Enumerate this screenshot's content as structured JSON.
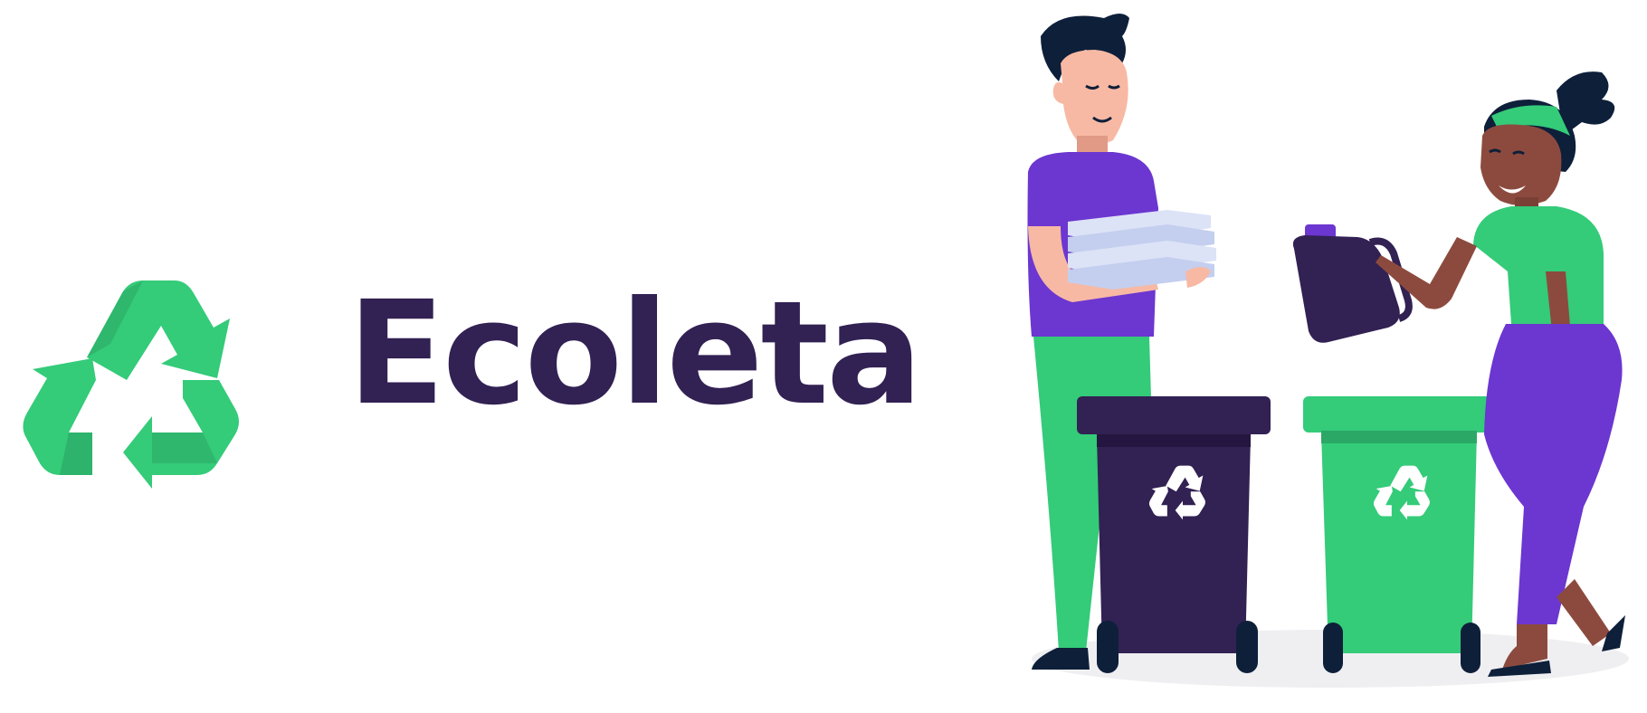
{
  "brand": {
    "name": "Ecoleta",
    "text_color": "#322153",
    "logo_icon": "recycle-icon",
    "accent_green": "#34CB79",
    "dark_green": "#2BA865"
  },
  "illustration": {
    "icons": [
      "man-figure",
      "woman-figure",
      "dark-recycle-bin",
      "green-recycle-bin",
      "paper-stack",
      "plastic-jug"
    ],
    "colors": {
      "purple": "#6C36D0",
      "dark": "#322153",
      "green": "#34CB79",
      "skin_light": "#F7B9A4",
      "skin_dark": "#8C4A3E"
    }
  }
}
